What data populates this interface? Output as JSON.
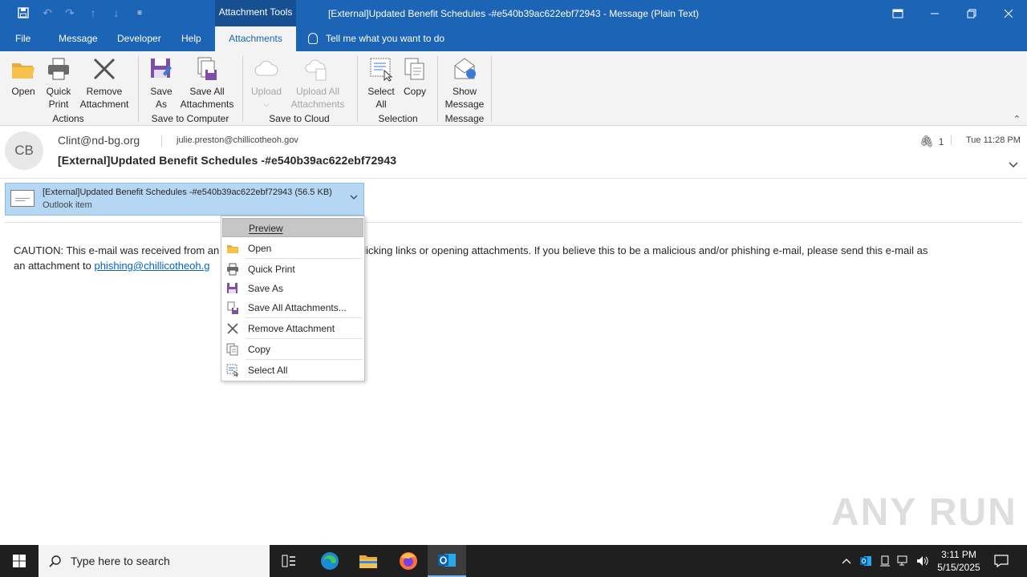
{
  "window": {
    "context_tab_group": "Attachment Tools",
    "title": "[External]Updated Benefit Schedules -#e540b39ac622ebf72943  -  Message (Plain Text)"
  },
  "tabs": [
    {
      "label": "File"
    },
    {
      "label": "Message"
    },
    {
      "label": "Developer"
    },
    {
      "label": "Help"
    },
    {
      "label": "Attachments"
    }
  ],
  "tell_me": "Tell me what you want to do",
  "ribbon": {
    "open": "Open",
    "quick_print_1": "Quick",
    "quick_print_2": "Print",
    "remove_1": "Remove",
    "remove_2": "Attachment",
    "group_actions": "Actions",
    "save_as_1": "Save",
    "save_as_2": "As",
    "save_all_1": "Save All",
    "save_all_2": "Attachments",
    "group_save_computer": "Save to Computer",
    "upload": "Upload",
    "upload_all_1": "Upload All",
    "upload_all_2": "Attachments",
    "group_save_cloud": "Save to Cloud",
    "select_all_1": "Select",
    "select_all_2": "All",
    "copy": "Copy",
    "group_selection": "Selection",
    "show_message_1": "Show",
    "show_message_2": "Message",
    "group_message": "Message"
  },
  "header": {
    "avatar_initials": "CB",
    "from": "Clint@nd-bg.org",
    "to": "julie.preston@chillicotheoh.gov",
    "subject": "[External]Updated Benefit Schedules -#e540b39ac622ebf72943",
    "attachment_count": "1",
    "time": "Tue 11:28 PM"
  },
  "attachment": {
    "name": "[External]Updated Benefit Schedules -#e540b39ac622ebf72943 (56.5 KB)",
    "type": "Outlook item"
  },
  "body": {
    "line1_start": "CAUTION: This e-mail was received from an",
    "line1_end": "n when clicking links or opening attachments. If you believe this to be a malicious and/or phishing e-mail, please send this e-mail as",
    "line2_start": "an attachment to",
    "link": "phishing@chillicotheoh.g"
  },
  "context_menu": [
    {
      "label": "Preview",
      "icon": "none"
    },
    {
      "label": "Open",
      "icon": "folder-icon"
    },
    {
      "label": "Quick Print",
      "icon": "printer-icon"
    },
    {
      "label": "Save As",
      "icon": "save-icon"
    },
    {
      "label": "Save All Attachments...",
      "icon": "save-all-icon"
    },
    {
      "label": "Remove Attachment",
      "icon": "close-icon"
    },
    {
      "label": "Copy",
      "icon": "copy-icon"
    },
    {
      "label": "Select All",
      "icon": "select-all-icon"
    }
  ],
  "watermark": "ANY RUN",
  "taskbar": {
    "search_placeholder": "Type here to search",
    "time": "3:11 PM",
    "date": "5/15/2025"
  },
  "colors": {
    "titlebar": "#1c64b6",
    "ribbon": "#f3f3f3",
    "attachment_selected": "#b6d7f3",
    "menu_highlight": "#c6c6c6",
    "link": "#0563c1"
  }
}
